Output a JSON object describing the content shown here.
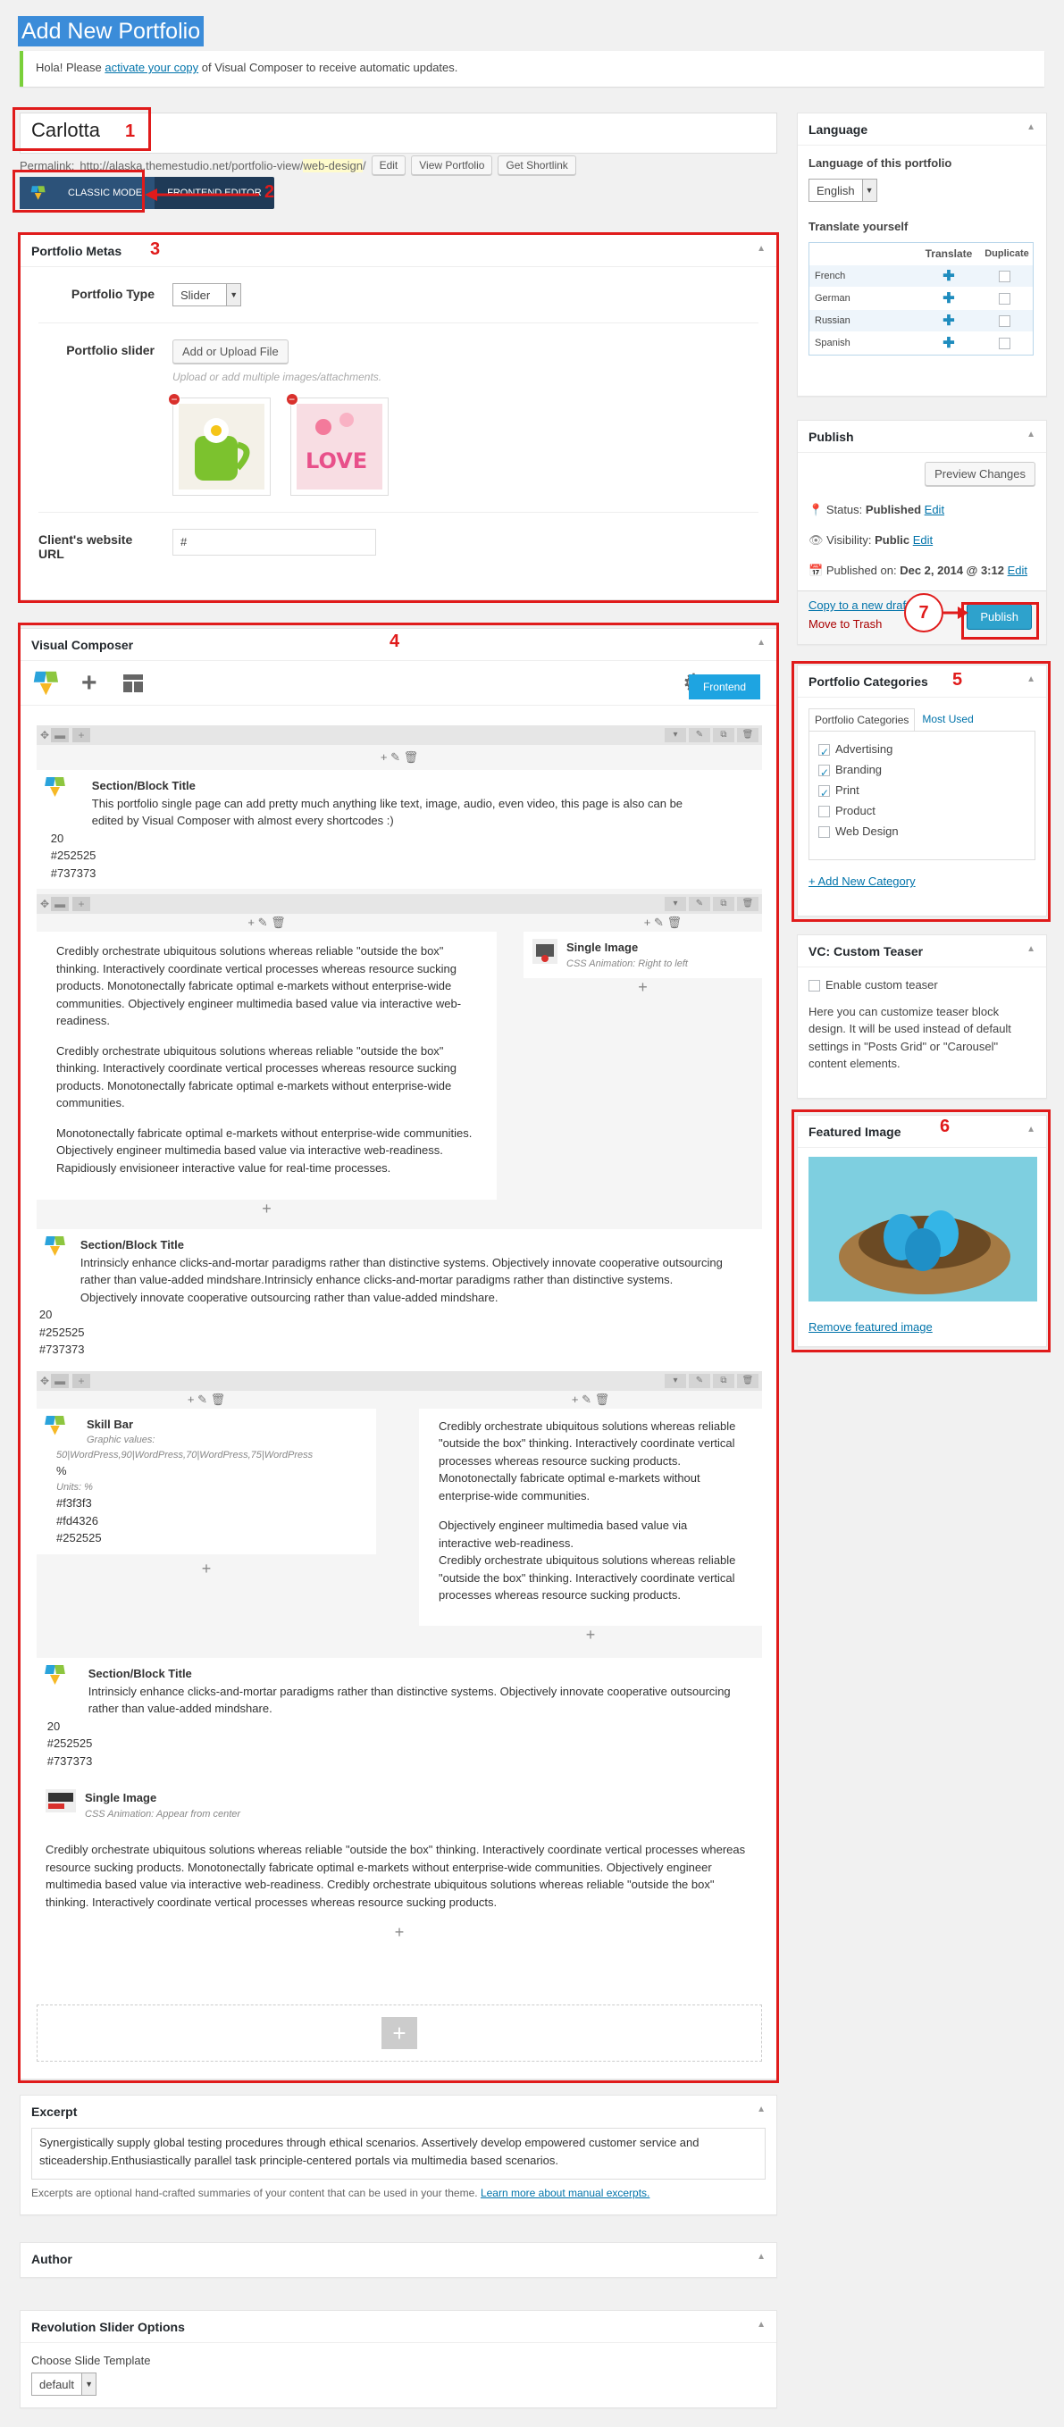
{
  "page": {
    "title": "Add New Portfolio",
    "notice_prefix": "Hola! Please",
    "notice_link": "activate your copy",
    "notice_suffix": "of Visual Composer to receive automatic updates."
  },
  "post": {
    "title": "Carlotta",
    "permalink_label": "Permalink:",
    "permalink_base": "http://alaska.themestudio.net/portfolio-view/",
    "permalink_slug": "web-design",
    "permalink_end": "/",
    "edit_label": "Edit",
    "view_label": "View Portfolio",
    "shortlink_label": "Get Shortlink"
  },
  "modes": {
    "classic": "CLASSIC MODE",
    "frontend": "FRONTEND EDITOR"
  },
  "annotations": {
    "n1": "1",
    "n2": "2",
    "n3": "3",
    "n4": "4",
    "n5": "5",
    "n6": "6",
    "n7": "7"
  },
  "metas": {
    "title": "Portfolio Metas",
    "type_label": "Portfolio Type",
    "type_value": "Slider",
    "slider_label": "Portfolio slider",
    "upload_button": "Add or Upload File",
    "upload_hint": "Upload or add multiple images/attachments.",
    "url_label": "Client's website URL",
    "url_value": "#"
  },
  "vc": {
    "title": "Visual Composer",
    "frontend_button": "Frontend",
    "section1": {
      "title": "Section/Block Title",
      "desc": "This portfolio single page can add pretty much anything like text, image, audio, even video, this page is also can be edited by Visual Composer with almost every shortcodes :)",
      "v1": "20",
      "v2": "#252525",
      "v3": "#737373"
    },
    "text1": {
      "p1": "Credibly orchestrate ubiquitous solutions whereas reliable \"outside the box\" thinking. Interactively coordinate vertical processes whereas resource sucking products. Monotonectally fabricate optimal e-markets without enterprise-wide communities. Objectively engineer multimedia based value via interactive web-readiness.",
      "p2": "Credibly orchestrate ubiquitous solutions whereas reliable \"outside the box\" thinking. Interactively coordinate vertical processes whereas resource sucking products. Monotonectally fabricate optimal e-markets without enterprise-wide communities.",
      "p3": "Monotonectally fabricate optimal e-markets without enterprise-wide communities. Objectively engineer multimedia based value via interactive web-readiness. Rapidiously envisioneer interactive value for real-time processes."
    },
    "image1": {
      "title": "Single Image",
      "sub": "CSS Animation: Right to left"
    },
    "section2": {
      "title": "Section/Block Title",
      "desc": "Intrinsicly enhance clicks-and-mortar paradigms rather than distinctive systems. Objectively innovate cooperative outsourcing rather than value-added mindshare.Intrinsicly enhance clicks-and-mortar paradigms rather than distinctive systems. Objectively innovate cooperative outsourcing rather than value-added mindshare.",
      "v1": "20",
      "v2": "#252525",
      "v3": "#737373"
    },
    "skillbar": {
      "title": "Skill Bar",
      "sub1": "Graphic values:",
      "values": "50|WordPress,90|WordPress,70|WordPress,75|WordPress",
      "percent": "%",
      "units": "Units: %",
      "c1": "#f3f3f3",
      "c2": "#fd4326",
      "c3": "#252525"
    },
    "text2": {
      "p1": "Credibly orchestrate ubiquitous solutions whereas reliable \"outside the box\" thinking. Interactively coordinate vertical processes whereas resource sucking products. Monotonectally fabricate optimal e-markets without enterprise-wide communities.",
      "p2": "Objectively engineer multimedia based value via interactive web-readiness.",
      "p3": "Credibly orchestrate ubiquitous solutions whereas reliable \"outside the box\" thinking. Interactively coordinate vertical processes whereas resource sucking products."
    },
    "section3": {
      "title": "Section/Block Title",
      "desc": "Intrinsicly enhance clicks-and-mortar paradigms rather than distinctive systems. Objectively innovate cooperative outsourcing rather than value-added mindshare.",
      "v1": "20",
      "v2": "#252525",
      "v3": "#737373"
    },
    "image2": {
      "title": "Single Image",
      "sub": "CSS Animation: Appear from center"
    },
    "text3": "Credibly orchestrate ubiquitous solutions whereas reliable \"outside the box\" thinking. Interactively coordinate vertical processes whereas resource sucking products. Monotonectally fabricate optimal e-markets without enterprise-wide communities. Objectively engineer multimedia based value via interactive web-readiness. Credibly orchestrate ubiquitous solutions whereas reliable \"outside the box\" thinking. Interactively coordinate vertical processes whereas resource sucking products."
  },
  "excerpt": {
    "title": "Excerpt",
    "value": "Synergistically supply global testing procedures through ethical scenarios. Assertively develop empowered customer service and sticeadership.Enthusiastically parallel task principle-centered portals via multimedia based scenarios.",
    "help": "Excerpts are optional hand-crafted summaries of your content that can be used in your theme.",
    "help_link": "Learn more about manual excerpts."
  },
  "author": {
    "title": "Author"
  },
  "revslider": {
    "title": "Revolution Slider Options",
    "label": "Choose Slide Template",
    "value": "default"
  },
  "language": {
    "title": "Language",
    "of_label": "Language of this portfolio",
    "value": "English",
    "translate_label": "Translate yourself",
    "col_translate": "Translate",
    "col_duplicate": "Duplicate",
    "rows": [
      "French",
      "German",
      "Russian",
      "Spanish"
    ]
  },
  "publish": {
    "title": "Publish",
    "preview": "Preview Changes",
    "status_label": "Status:",
    "status_value": "Published",
    "visibility_label": "Visibility:",
    "visibility_value": "Public",
    "published_label": "Published on:",
    "published_value": "Dec 2, 2014 @ 3:12",
    "edit": "Edit",
    "copy_draft": "Copy to a new draft",
    "trash": "Move to Trash",
    "publish_button": "Publish"
  },
  "categories": {
    "title": "Portfolio Categories",
    "tab_all": "Portfolio Categories",
    "tab_used": "Most Used",
    "items": [
      "Advertising",
      "Branding",
      "Print",
      "Product",
      "Web Design"
    ],
    "add_new": "+ Add New Category"
  },
  "teaser": {
    "title": "VC: Custom Teaser",
    "enable": "Enable custom teaser",
    "desc": "Here you can customize teaser block design. It will be used instead of default settings in \"Posts Grid\" or \"Carousel\" content elements."
  },
  "featured": {
    "title": "Featured Image",
    "remove": "Remove featured image"
  },
  "colors": {
    "annotation": "#e01b1b",
    "accent": "#2ea2cc",
    "link": "#0073aa"
  }
}
